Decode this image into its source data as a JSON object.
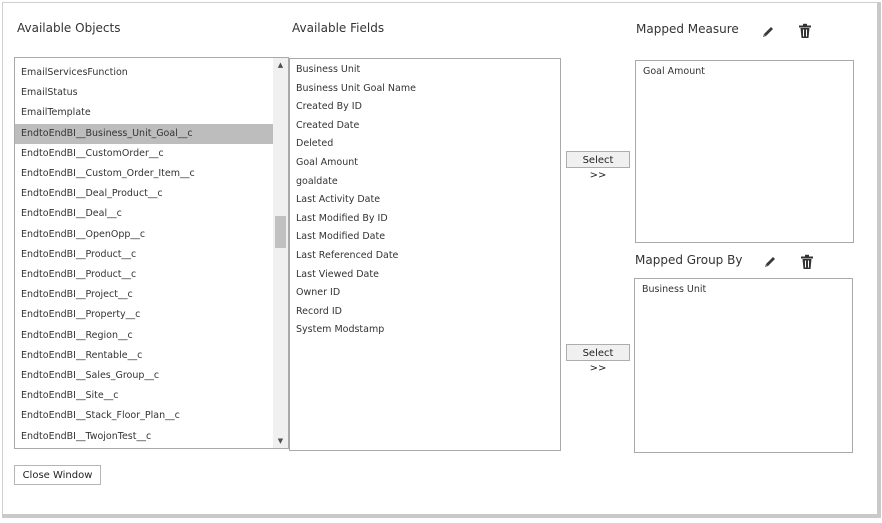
{
  "available_objects": {
    "heading": "Available Objects",
    "items": [
      "EmailServicesFunction",
      "EmailStatus",
      "EmailTemplate",
      "EndtoEndBI__Business_Unit_Goal__c",
      "EndtoEndBI__CustomOrder__c",
      "EndtoEndBI__Custom_Order_Item__c",
      "EndtoEndBI__Deal_Product__c",
      "EndtoEndBI__Deal__c",
      "EndtoEndBI__OpenOpp__c",
      "EndtoEndBI__Product__c",
      "EndtoEndBI__Product__c",
      "EndtoEndBI__Project__c",
      "EndtoEndBI__Property__c",
      "EndtoEndBI__Region__c",
      "EndtoEndBI__Rentable__c",
      "EndtoEndBI__Sales_Group__c",
      "EndtoEndBI__Site__c",
      "EndtoEndBI__Stack_Floor_Plan__c",
      "EndtoEndBI__TwojonTest__c"
    ],
    "selected_item": "EndtoEndBI__Business_Unit_Goal__c"
  },
  "available_fields": {
    "heading": "Available Fields",
    "items": [
      "Business Unit",
      "Business Unit Goal Name",
      "Created By ID",
      "Created Date",
      "Deleted",
      "Goal Amount",
      "goaldate",
      "Last Activity Date",
      "Last Modified By ID",
      "Last Modified Date",
      "Last Referenced Date",
      "Last Viewed Date",
      "Owner ID",
      "Record ID",
      "System Modstamp"
    ]
  },
  "select_buttons": {
    "measure_label": "Select >>",
    "group_label": "Select >>"
  },
  "mapped_measure": {
    "heading": "Mapped Measure",
    "value": "Goal Amount",
    "edit_icon": "pencil-icon",
    "delete_icon": "trash-icon"
  },
  "mapped_group_by": {
    "heading": "Mapped Group By",
    "value": "Business Unit",
    "edit_icon": "pencil-icon",
    "delete_icon": "trash-icon"
  },
  "footer": {
    "close_label": "Close Window"
  },
  "colors": {
    "selected_row": "#bdbdbd",
    "border": "#a9a9a9",
    "button_bg": "#f0f0f0"
  }
}
